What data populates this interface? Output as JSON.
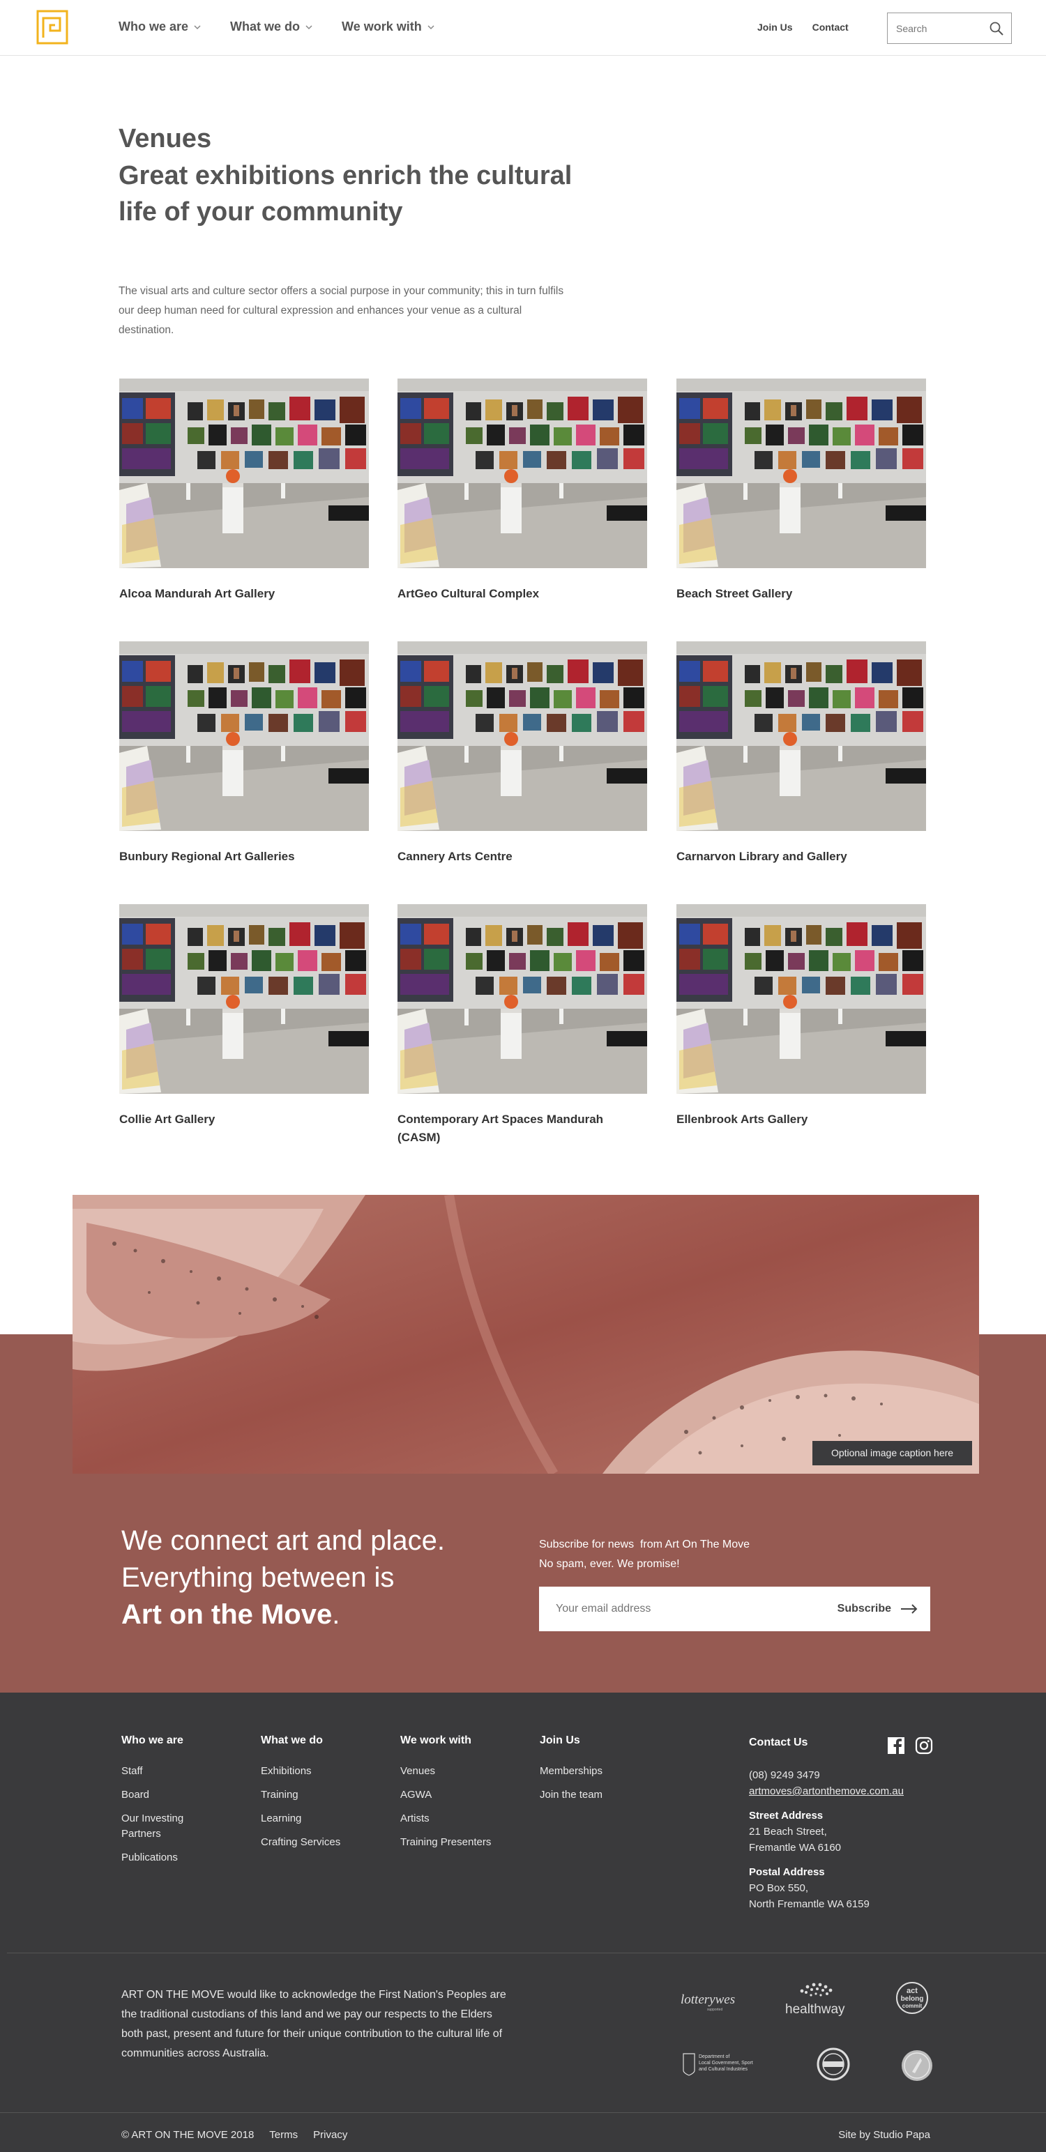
{
  "header": {
    "nav": [
      "Who we are",
      "What we do",
      "We work with"
    ],
    "join_label": "Join Us",
    "contact_label": "Contact",
    "search_placeholder": "Search",
    "brand_color": "#f2b31d"
  },
  "intro": {
    "title": "Venues",
    "subtitle": "Great exhibitions enrich the cultural life of your community",
    "text": "The visual arts and culture sector offers a social purpose in your community; this in turn fulfils our deep human need for cultural expression and enhances your venue as a cultural destination."
  },
  "venues": [
    {
      "name": "Alcoa Mandurah Art Gallery"
    },
    {
      "name": "ArtGeo Cultural Complex"
    },
    {
      "name": "Beach Street Gallery"
    },
    {
      "name": "Bunbury Regional Art Galleries"
    },
    {
      "name": "Cannery Arts Centre"
    },
    {
      "name": "Carnarvon Library and Gallery"
    },
    {
      "name": "Collie Art Gallery"
    },
    {
      "name": "Contemporary Art Spaces Mandurah (CASM)"
    },
    {
      "name": "Ellenbrook Arts Gallery"
    }
  ],
  "banner": {
    "caption": "Optional image caption here",
    "band_color": "#965a52"
  },
  "promo": {
    "line1": "We connect art and place.",
    "line2": "Everything between is",
    "brand": "Art on the Move",
    "period": ".",
    "subscribe_line1": "Subscribe for news  from Art On The Move",
    "subscribe_line2": "No spam, ever. We promise!",
    "email_placeholder": "Your email address",
    "subscribe_label": "Subscribe"
  },
  "footer": {
    "columns": [
      {
        "title": "Who we are",
        "links": [
          "Staff",
          "Board",
          "Our Investing Partners",
          "Publications"
        ]
      },
      {
        "title": "What we do",
        "links": [
          "Exhibitions",
          "Training",
          "Learning",
          "Crafting Services"
        ]
      },
      {
        "title": "We work with",
        "links": [
          "Venues",
          "AGWA",
          "Artists",
          "Training Presenters"
        ]
      },
      {
        "title": "Join Us",
        "links": [
          "Memberships",
          "Join the team"
        ]
      }
    ],
    "contact": {
      "title": "Contact Us",
      "phone": "(08) 9249 3479",
      "email": "artmoves@artonthemove.com.au",
      "street_label": "Street Address",
      "street_1": "21 Beach Street,",
      "street_2": "Fremantle WA 6160",
      "postal_label": "Postal Address",
      "postal_1": "PO Box 550,",
      "postal_2": "North Fremantle WA 6159"
    },
    "social_icons": [
      "facebook-icon",
      "instagram-icon"
    ],
    "acknowledgement": "ART ON THE MOVE would like to acknowledge the First Nation's Peoples are the traditional custodians of this land and we pay our respects to the Elders both past, present and future for their unique contribution to the cultural life of communities across Australia.",
    "sponsors": {
      "lotterywest": "lotterywest",
      "lotterywest_sub": "supported",
      "healthway": "healthway",
      "act_belong_1": "act",
      "act_belong_2": "belong",
      "act_belong_3": "commit",
      "dlgsc_1": "Department of",
      "dlgsc_2": "Local Government, Sport",
      "dlgsc_3": "and Cultural Industries"
    },
    "copyright": "© ART ON THE MOVE 2018",
    "terms": "Terms",
    "privacy": "Privacy",
    "credit": "Site by Studio Papa"
  }
}
